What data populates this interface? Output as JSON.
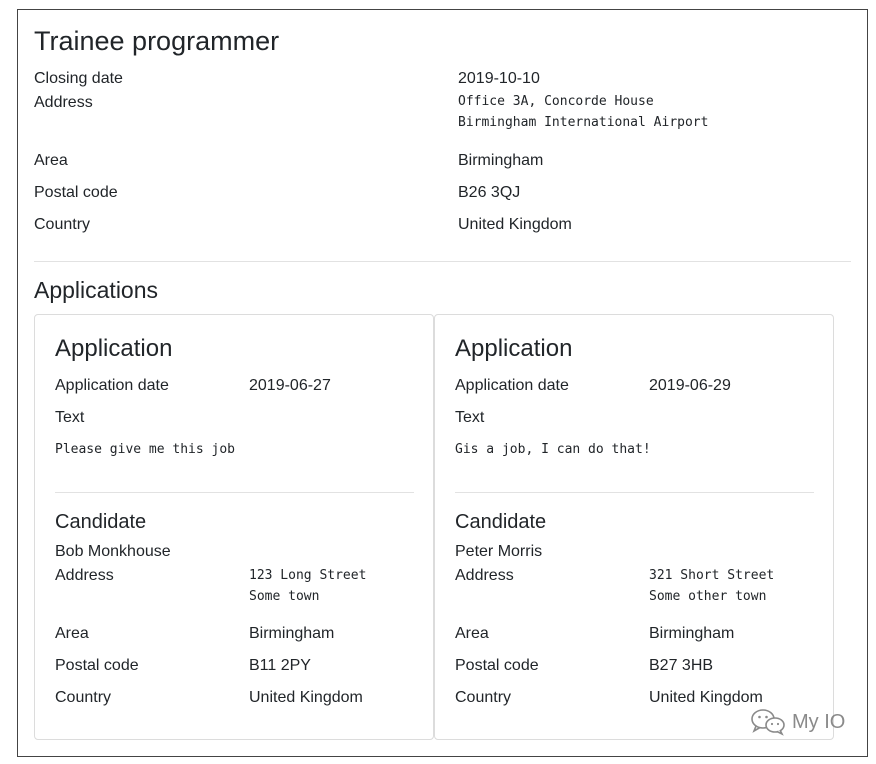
{
  "job": {
    "title": "Trainee programmer",
    "closing_date_label": "Closing date",
    "closing_date": "2019-10-10",
    "address_label": "Address",
    "address": "Office 3A, Concorde House\nBirmingham International Airport",
    "area_label": "Area",
    "area": "Birmingham",
    "postal_code_label": "Postal code",
    "postal_code": "B26 3QJ",
    "country_label": "Country",
    "country": "United Kingdom"
  },
  "applications_title": "Applications",
  "applications": [
    {
      "title": "Application",
      "date_label": "Application date",
      "date": "2019-06-27",
      "text_label": "Text",
      "text": "Please give me this job",
      "candidate_title": "Candidate",
      "candidate_name": "Bob Monkhouse",
      "address_label": "Address",
      "address": "123 Long Street\nSome town",
      "area_label": "Area",
      "area": "Birmingham",
      "postal_code_label": "Postal code",
      "postal_code": "B11 2PY",
      "country_label": "Country",
      "country": "United Kingdom"
    },
    {
      "title": "Application",
      "date_label": "Application date",
      "date": "2019-06-29",
      "text_label": "Text",
      "text": "Gis a job, I can do that!",
      "candidate_title": "Candidate",
      "candidate_name": "Peter Morris",
      "address_label": "Address",
      "address": "321 Short Street\nSome other town",
      "area_label": "Area",
      "area": "Birmingham",
      "postal_code_label": "Postal code",
      "postal_code": "B27 3HB",
      "country_label": "Country",
      "country": "United Kingdom"
    }
  ],
  "watermark": {
    "text": "My IO",
    "icon": "wechat-icon"
  }
}
